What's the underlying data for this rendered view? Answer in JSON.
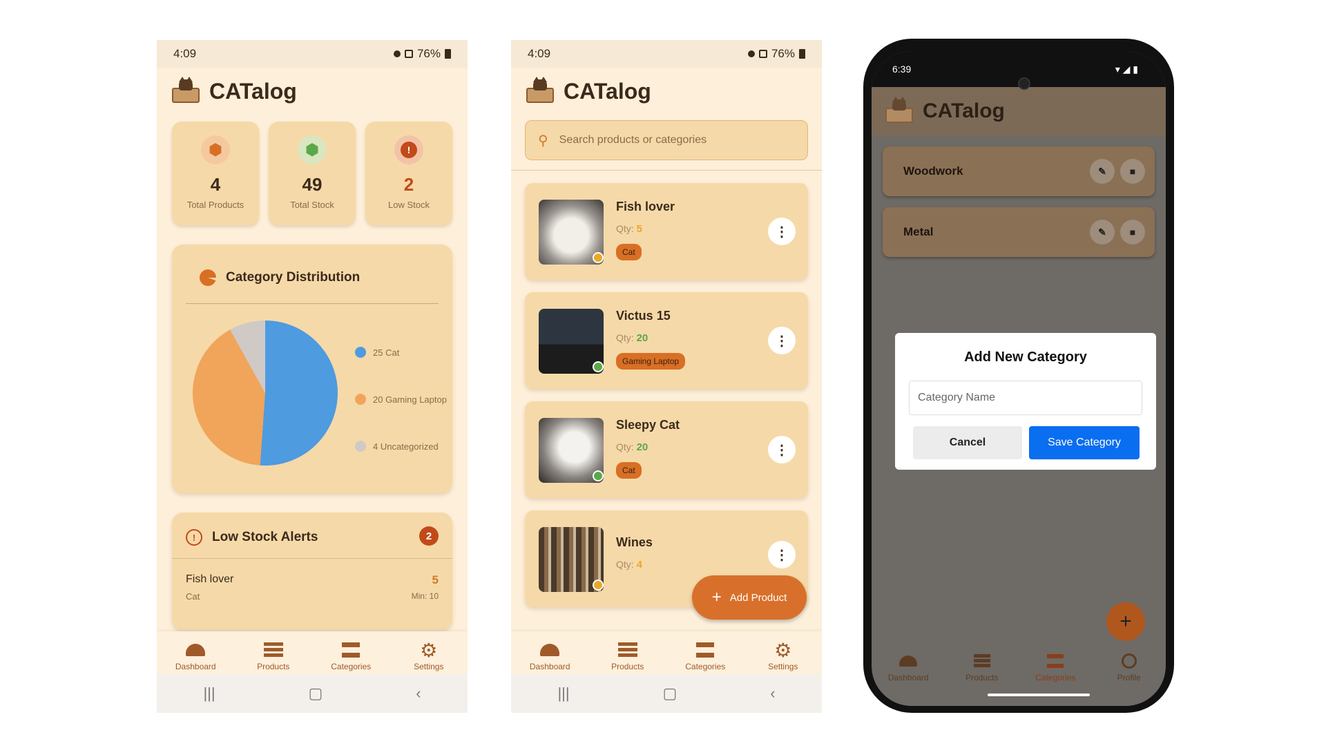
{
  "phone1": {
    "status": {
      "time": "4:09",
      "battery": "76%"
    },
    "app_title": "CATalog",
    "stats": [
      {
        "value": "4",
        "label": "Total Products",
        "color": "#d86f24",
        "icon": "box-icon"
      },
      {
        "value": "49",
        "label": "Total Stock",
        "color": "#5aa84a",
        "icon": "box-icon"
      },
      {
        "value": "2",
        "label": "Low Stock",
        "color": "#c24a1a",
        "icon": "alert-icon"
      }
    ],
    "category_title": "Category Distribution",
    "legend": [
      {
        "label": "25 Cat",
        "color": "#4e9be0"
      },
      {
        "label": "20 Gaming Laptop",
        "color": "#f0a55a"
      },
      {
        "label": "4 Uncategorized",
        "color": "#cfcac6"
      }
    ],
    "low_stock": {
      "title": "Low Stock Alerts",
      "count": "2",
      "item": {
        "name": "Fish lover",
        "category": "Cat",
        "qty": "5",
        "min": "Min: 10"
      }
    },
    "nav": [
      "Dashboard",
      "Products",
      "Categories",
      "Settings"
    ]
  },
  "phone2": {
    "status": {
      "time": "4:09",
      "battery": "76%"
    },
    "app_title": "CATalog",
    "search_placeholder": "Search products or categories",
    "products": [
      {
        "name": "Fish lover",
        "qty_label": "Qty:",
        "qty": "5",
        "tag": "Cat",
        "qty_color": "#e8a92a",
        "dot_color": "#e8a92a"
      },
      {
        "name": "Victus 15",
        "qty_label": "Qty:",
        "qty": "20",
        "tag": "Gaming Laptop",
        "qty_color": "#5aa84a",
        "dot_color": "#5aa84a"
      },
      {
        "name": "Sleepy Cat",
        "qty_label": "Qty:",
        "qty": "20",
        "tag": "Cat",
        "qty_color": "#5aa84a",
        "dot_color": "#5aa84a"
      },
      {
        "name": "Wines",
        "qty_label": "Qty:",
        "qty": "4",
        "tag": "",
        "qty_color": "#e8a92a",
        "dot_color": "#e8a92a"
      }
    ],
    "add_product": "Add Product",
    "nav": [
      "Dashboard",
      "Products",
      "Categories",
      "Settings"
    ]
  },
  "phone3": {
    "status": {
      "time": "6:39"
    },
    "app_title": "CATalog",
    "categories": [
      "Woodwork",
      "Metal"
    ],
    "dialog": {
      "title": "Add New Category",
      "placeholder": "Category Name",
      "cancel": "Cancel",
      "save": "Save Category"
    },
    "nav": [
      "Dashboard",
      "Products",
      "Categories",
      "Profile"
    ]
  }
}
